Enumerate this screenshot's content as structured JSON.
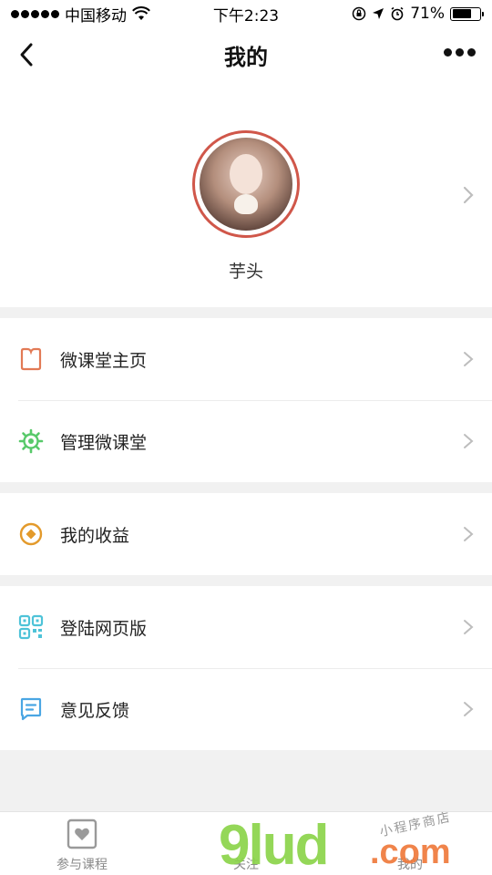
{
  "status_bar": {
    "carrier": "中国移动",
    "time": "下午2:23",
    "battery": "71%",
    "battery_level": 0.71
  },
  "nav": {
    "title": "我的",
    "back_icon": "chevron-left-icon",
    "more_icon": "more-dots-icon"
  },
  "profile": {
    "name": "芋头",
    "ring_color": "#d0574a"
  },
  "groups": [
    {
      "items": [
        {
          "label": "微课堂主页",
          "icon": "bookmark-icon",
          "color": "#e27a55"
        },
        {
          "label": "管理微课堂",
          "icon": "gear-icon",
          "color": "#58c96a"
        }
      ]
    },
    {
      "items": [
        {
          "label": "我的收益",
          "icon": "coin-icon",
          "color": "#e39a2b"
        }
      ]
    },
    {
      "items": [
        {
          "label": "登陆网页版",
          "icon": "qrcode-icon",
          "color": "#4ec3d8"
        },
        {
          "label": "意见反馈",
          "icon": "feedback-icon",
          "color": "#4aa6e3"
        }
      ]
    }
  ],
  "tabbar": {
    "tabs": [
      {
        "label": "参与课程",
        "icon": "heart-box-icon"
      },
      {
        "label": "关注",
        "icon": "follow-icon"
      },
      {
        "label": "我的",
        "icon": "profile-icon"
      }
    ]
  },
  "watermark": {
    "main": "9lud",
    "dotcom": ".com",
    "small": "小程序商店"
  }
}
